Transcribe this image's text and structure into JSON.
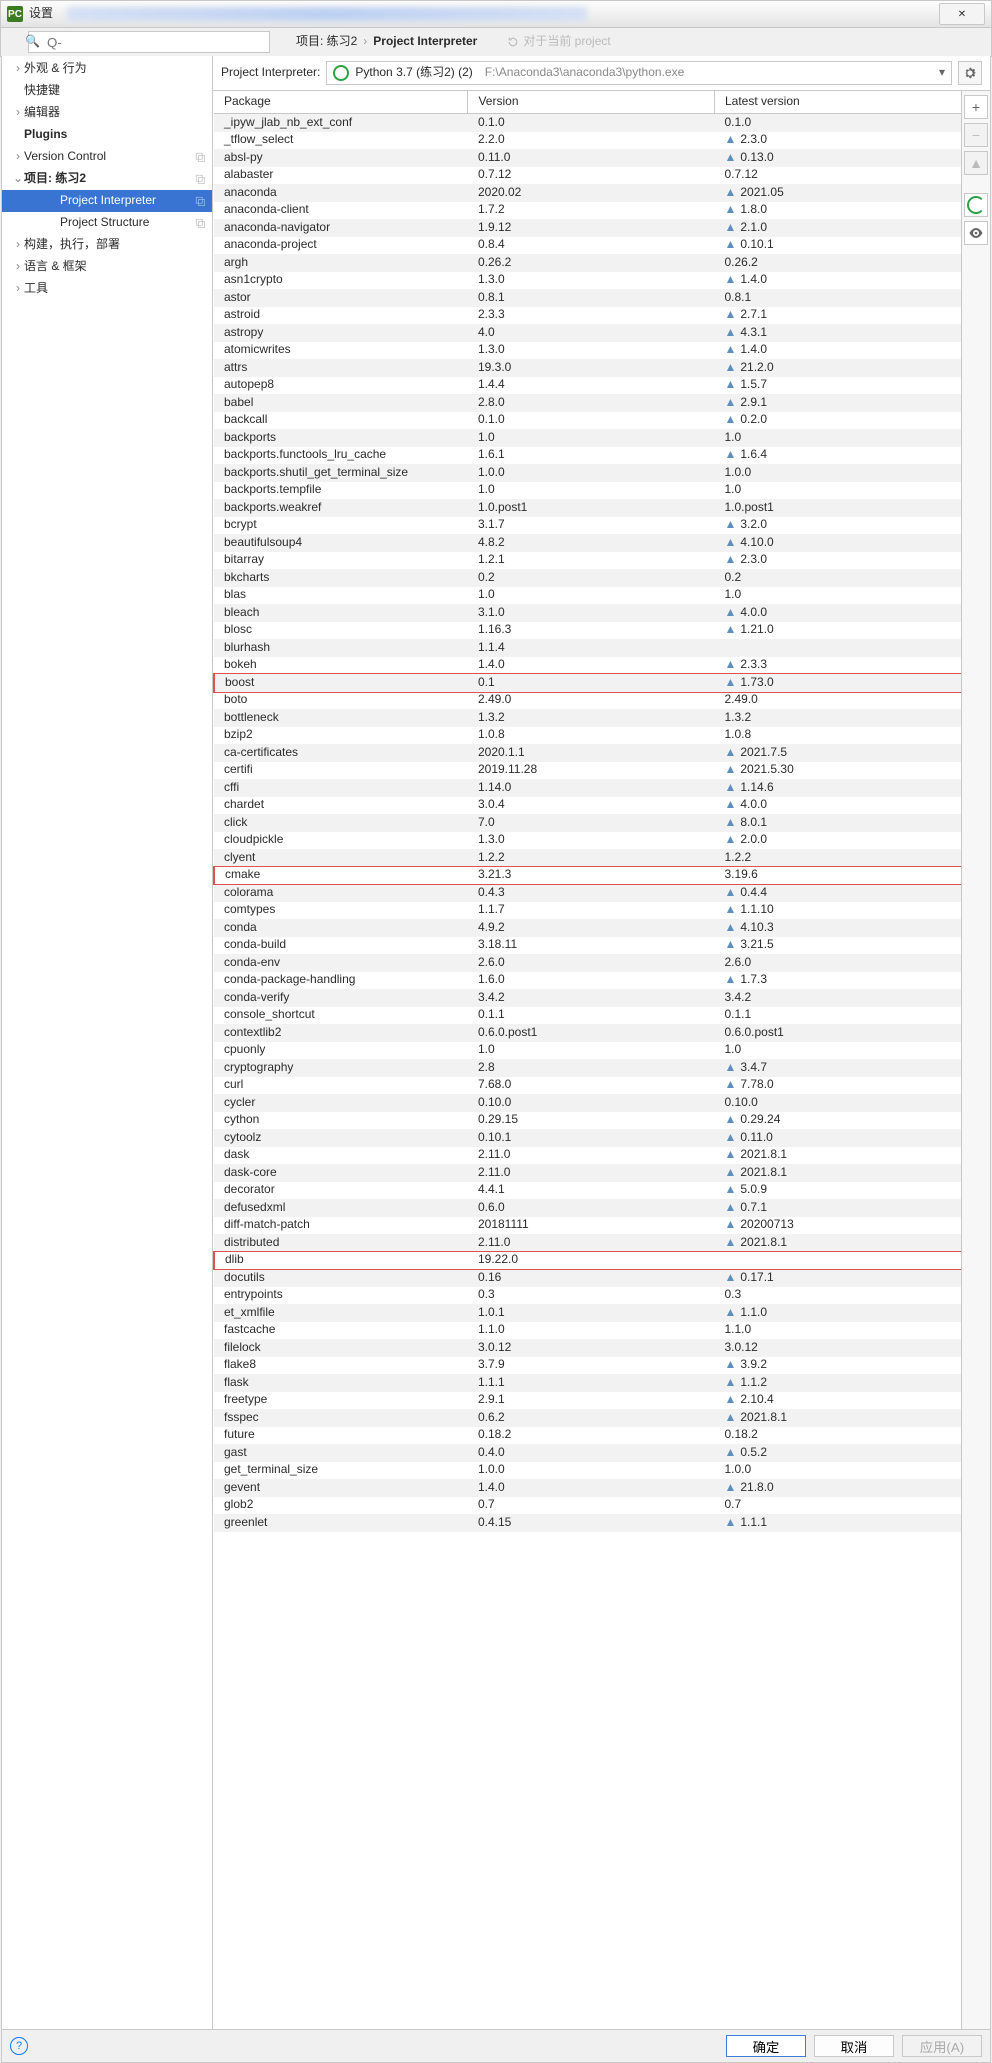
{
  "window": {
    "title": "设置",
    "close": "✕"
  },
  "search": {
    "placeholder": "Q-"
  },
  "breadcrumb": {
    "a": "项目: 练习2",
    "sep": "›",
    "b": "Project Interpreter"
  },
  "reset": {
    "label": "对于当前 project"
  },
  "nav": [
    {
      "label": "外观 & 行为",
      "chevron": ">",
      "lvl": 1
    },
    {
      "label": "快捷键",
      "chevron": "",
      "lvl": 1
    },
    {
      "label": "编辑器",
      "chevron": ">",
      "lvl": 1
    },
    {
      "label": "Plugins",
      "chevron": "",
      "lvl": 1,
      "bold": true
    },
    {
      "label": "Version Control",
      "chevron": ">",
      "lvl": 1,
      "copy": true
    },
    {
      "label": "项目: 练习2",
      "chevron": "v",
      "lvl": 1,
      "bold": true,
      "copy": true
    },
    {
      "label": "Project Interpreter",
      "chevron": "",
      "lvl": 3,
      "copy": true,
      "selected": true
    },
    {
      "label": "Project Structure",
      "chevron": "",
      "lvl": 3,
      "copy": true
    },
    {
      "label": "构建，执行，部署",
      "chevron": ">",
      "lvl": 1
    },
    {
      "label": "语言 & 框架",
      "chevron": ">",
      "lvl": 1
    },
    {
      "label": "工具",
      "chevron": ">",
      "lvl": 1
    }
  ],
  "interpreter": {
    "label": "Project Interpreter:",
    "name": "Python 3.7 (练习2) (2)",
    "path": "F:\\Anaconda3\\anaconda3\\python.exe"
  },
  "columns": {
    "package": "Package",
    "version": "Version",
    "latest": "Latest version"
  },
  "sidebuttons": {
    "add": "+",
    "remove": "−",
    "up": "▲",
    "eye": "◉"
  },
  "footer": {
    "ok": "确定",
    "cancel": "取消",
    "apply": "应用(A)"
  },
  "highlights": [
    "boost",
    "cmake",
    "dlib"
  ],
  "packages": [
    {
      "p": "_ipyw_jlab_nb_ext_conf",
      "v": "0.1.0",
      "l": "0.1.0",
      "u": false
    },
    {
      "p": "_tflow_select",
      "v": "2.2.0",
      "l": "2.3.0",
      "u": true
    },
    {
      "p": "absl-py",
      "v": "0.11.0",
      "l": "0.13.0",
      "u": true
    },
    {
      "p": "alabaster",
      "v": "0.7.12",
      "l": "0.7.12",
      "u": false
    },
    {
      "p": "anaconda",
      "v": "2020.02",
      "l": "2021.05",
      "u": true
    },
    {
      "p": "anaconda-client",
      "v": "1.7.2",
      "l": "1.8.0",
      "u": true
    },
    {
      "p": "anaconda-navigator",
      "v": "1.9.12",
      "l": "2.1.0",
      "u": true
    },
    {
      "p": "anaconda-project",
      "v": "0.8.4",
      "l": "0.10.1",
      "u": true
    },
    {
      "p": "argh",
      "v": "0.26.2",
      "l": "0.26.2",
      "u": false
    },
    {
      "p": "asn1crypto",
      "v": "1.3.0",
      "l": "1.4.0",
      "u": true
    },
    {
      "p": "astor",
      "v": "0.8.1",
      "l": "0.8.1",
      "u": false
    },
    {
      "p": "astroid",
      "v": "2.3.3",
      "l": "2.7.1",
      "u": true
    },
    {
      "p": "astropy",
      "v": "4.0",
      "l": "4.3.1",
      "u": true
    },
    {
      "p": "atomicwrites",
      "v": "1.3.0",
      "l": "1.4.0",
      "u": true
    },
    {
      "p": "attrs",
      "v": "19.3.0",
      "l": "21.2.0",
      "u": true
    },
    {
      "p": "autopep8",
      "v": "1.4.4",
      "l": "1.5.7",
      "u": true
    },
    {
      "p": "babel",
      "v": "2.8.0",
      "l": "2.9.1",
      "u": true
    },
    {
      "p": "backcall",
      "v": "0.1.0",
      "l": "0.2.0",
      "u": true
    },
    {
      "p": "backports",
      "v": "1.0",
      "l": "1.0",
      "u": false
    },
    {
      "p": "backports.functools_lru_cache",
      "v": "1.6.1",
      "l": "1.6.4",
      "u": true
    },
    {
      "p": "backports.shutil_get_terminal_size",
      "v": "1.0.0",
      "l": "1.0.0",
      "u": false
    },
    {
      "p": "backports.tempfile",
      "v": "1.0",
      "l": "1.0",
      "u": false
    },
    {
      "p": "backports.weakref",
      "v": "1.0.post1",
      "l": "1.0.post1",
      "u": false
    },
    {
      "p": "bcrypt",
      "v": "3.1.7",
      "l": "3.2.0",
      "u": true
    },
    {
      "p": "beautifulsoup4",
      "v": "4.8.2",
      "l": "4.10.0",
      "u": true
    },
    {
      "p": "bitarray",
      "v": "1.2.1",
      "l": "2.3.0",
      "u": true
    },
    {
      "p": "bkcharts",
      "v": "0.2",
      "l": "0.2",
      "u": false
    },
    {
      "p": "blas",
      "v": "1.0",
      "l": "1.0",
      "u": false
    },
    {
      "p": "bleach",
      "v": "3.1.0",
      "l": "4.0.0",
      "u": true
    },
    {
      "p": "blosc",
      "v": "1.16.3",
      "l": "1.21.0",
      "u": true
    },
    {
      "p": "blurhash",
      "v": "1.1.4",
      "l": "",
      "u": false
    },
    {
      "p": "bokeh",
      "v": "1.4.0",
      "l": "2.3.3",
      "u": true
    },
    {
      "p": "boost",
      "v": "0.1",
      "l": "1.73.0",
      "u": true
    },
    {
      "p": "boto",
      "v": "2.49.0",
      "l": "2.49.0",
      "u": false
    },
    {
      "p": "bottleneck",
      "v": "1.3.2",
      "l": "1.3.2",
      "u": false
    },
    {
      "p": "bzip2",
      "v": "1.0.8",
      "l": "1.0.8",
      "u": false
    },
    {
      "p": "ca-certificates",
      "v": "2020.1.1",
      "l": "2021.7.5",
      "u": true
    },
    {
      "p": "certifi",
      "v": "2019.11.28",
      "l": "2021.5.30",
      "u": true
    },
    {
      "p": "cffi",
      "v": "1.14.0",
      "l": "1.14.6",
      "u": true
    },
    {
      "p": "chardet",
      "v": "3.0.4",
      "l": "4.0.0",
      "u": true
    },
    {
      "p": "click",
      "v": "7.0",
      "l": "8.0.1",
      "u": true
    },
    {
      "p": "cloudpickle",
      "v": "1.3.0",
      "l": "2.0.0",
      "u": true
    },
    {
      "p": "clyent",
      "v": "1.2.2",
      "l": "1.2.2",
      "u": false
    },
    {
      "p": "cmake",
      "v": "3.21.3",
      "l": "3.19.6",
      "u": false
    },
    {
      "p": "colorama",
      "v": "0.4.3",
      "l": "0.4.4",
      "u": true
    },
    {
      "p": "comtypes",
      "v": "1.1.7",
      "l": "1.1.10",
      "u": true
    },
    {
      "p": "conda",
      "v": "4.9.2",
      "l": "4.10.3",
      "u": true
    },
    {
      "p": "conda-build",
      "v": "3.18.11",
      "l": "3.21.5",
      "u": true
    },
    {
      "p": "conda-env",
      "v": "2.6.0",
      "l": "2.6.0",
      "u": false
    },
    {
      "p": "conda-package-handling",
      "v": "1.6.0",
      "l": "1.7.3",
      "u": true
    },
    {
      "p": "conda-verify",
      "v": "3.4.2",
      "l": "3.4.2",
      "u": false
    },
    {
      "p": "console_shortcut",
      "v": "0.1.1",
      "l": "0.1.1",
      "u": false
    },
    {
      "p": "contextlib2",
      "v": "0.6.0.post1",
      "l": "0.6.0.post1",
      "u": false
    },
    {
      "p": "cpuonly",
      "v": "1.0",
      "l": "1.0",
      "u": false
    },
    {
      "p": "cryptography",
      "v": "2.8",
      "l": "3.4.7",
      "u": true
    },
    {
      "p": "curl",
      "v": "7.68.0",
      "l": "7.78.0",
      "u": true
    },
    {
      "p": "cycler",
      "v": "0.10.0",
      "l": "0.10.0",
      "u": false
    },
    {
      "p": "cython",
      "v": "0.29.15",
      "l": "0.29.24",
      "u": true
    },
    {
      "p": "cytoolz",
      "v": "0.10.1",
      "l": "0.11.0",
      "u": true
    },
    {
      "p": "dask",
      "v": "2.11.0",
      "l": "2021.8.1",
      "u": true
    },
    {
      "p": "dask-core",
      "v": "2.11.0",
      "l": "2021.8.1",
      "u": true
    },
    {
      "p": "decorator",
      "v": "4.4.1",
      "l": "5.0.9",
      "u": true
    },
    {
      "p": "defusedxml",
      "v": "0.6.0",
      "l": "0.7.1",
      "u": true
    },
    {
      "p": "diff-match-patch",
      "v": "20181111",
      "l": "20200713",
      "u": true
    },
    {
      "p": "distributed",
      "v": "2.11.0",
      "l": "2021.8.1",
      "u": true
    },
    {
      "p": "dlib",
      "v": "19.22.0",
      "l": "",
      "u": false
    },
    {
      "p": "docutils",
      "v": "0.16",
      "l": "0.17.1",
      "u": true
    },
    {
      "p": "entrypoints",
      "v": "0.3",
      "l": "0.3",
      "u": false
    },
    {
      "p": "et_xmlfile",
      "v": "1.0.1",
      "l": "1.1.0",
      "u": true
    },
    {
      "p": "fastcache",
      "v": "1.1.0",
      "l": "1.1.0",
      "u": false
    },
    {
      "p": "filelock",
      "v": "3.0.12",
      "l": "3.0.12",
      "u": false
    },
    {
      "p": "flake8",
      "v": "3.7.9",
      "l": "3.9.2",
      "u": true
    },
    {
      "p": "flask",
      "v": "1.1.1",
      "l": "1.1.2",
      "u": true
    },
    {
      "p": "freetype",
      "v": "2.9.1",
      "l": "2.10.4",
      "u": true
    },
    {
      "p": "fsspec",
      "v": "0.6.2",
      "l": "2021.8.1",
      "u": true
    },
    {
      "p": "future",
      "v": "0.18.2",
      "l": "0.18.2",
      "u": false
    },
    {
      "p": "gast",
      "v": "0.4.0",
      "l": "0.5.2",
      "u": true
    },
    {
      "p": "get_terminal_size",
      "v": "1.0.0",
      "l": "1.0.0",
      "u": false
    },
    {
      "p": "gevent",
      "v": "1.4.0",
      "l": "21.8.0",
      "u": true
    },
    {
      "p": "glob2",
      "v": "0.7",
      "l": "0.7",
      "u": false
    },
    {
      "p": "greenlet",
      "v": "0.4.15",
      "l": "1.1.1",
      "u": true
    }
  ]
}
